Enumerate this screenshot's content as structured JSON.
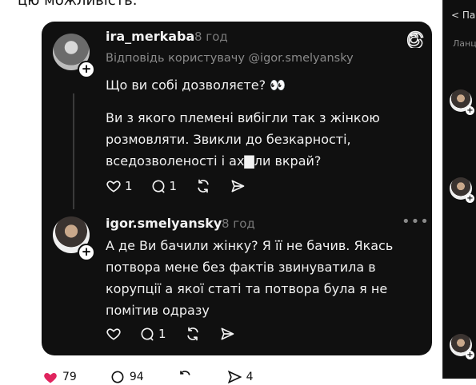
{
  "page_caption": "цю можливість.",
  "posts": [
    {
      "username": "ira_merkaba",
      "time": "8 год",
      "reply_to": "Відповідь користувачу @igor.smelyansky",
      "paragraphs": [
        "Що ви собі дозволяєте? 👀",
        "Ви з якого племені вибігли так з жінкою розмовляти. Звикли до безкарності, вседозволеності і ах▇ли вкрай?"
      ],
      "likes": "1",
      "replies": "1"
    },
    {
      "username": "igor.smelyansky",
      "time": "8 год",
      "paragraphs": [
        "А де Ви бачили жінку? Я її не бачив. Якась потвора мене без фактів звинуватила в корупції а якої статі та потвора була я не помітив одразу"
      ],
      "replies": "1"
    }
  ],
  "right_panel": {
    "tab": "< Па",
    "label": "Ланц"
  },
  "bottom_counts": {
    "likes": "79",
    "comments": "94",
    "reposts": "",
    "shares": "4"
  },
  "icons": [
    "threads-logo-icon",
    "heart-icon",
    "comment-icon",
    "repost-icon",
    "share-icon",
    "more-icon",
    "plus-icon"
  ],
  "colors": {
    "card_bg": "#101010",
    "accent_red": "#e0245e",
    "muted": "#7a7a7a"
  }
}
